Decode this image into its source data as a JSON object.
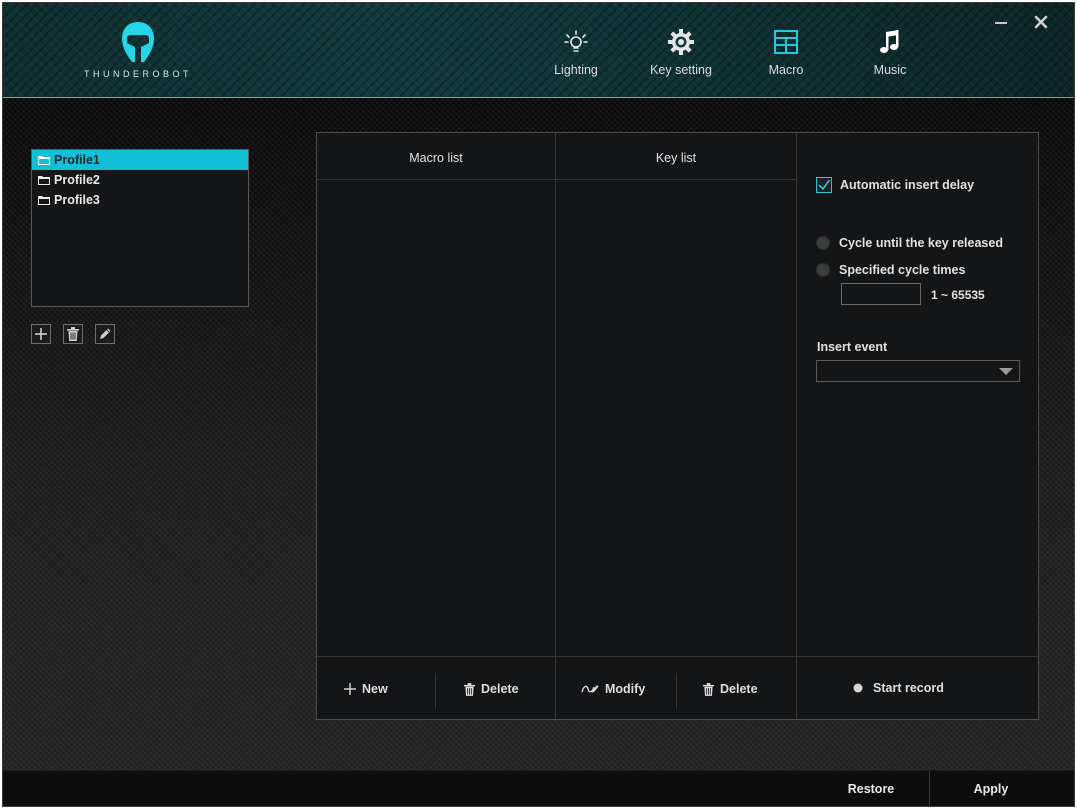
{
  "app": {
    "brand_name": "THUNDEROBOT",
    "accent_color": "#12c0d6"
  },
  "nav": {
    "tabs": [
      {
        "label": "Lighting",
        "icon": "light-bulb-icon"
      },
      {
        "label": "Key setting",
        "icon": "gear-icon"
      },
      {
        "label": "Macro",
        "icon": "grid-table-icon",
        "active": true
      },
      {
        "label": "Music",
        "icon": "music-note-icon"
      }
    ]
  },
  "window_controls": {
    "minimize_icon": "minimize-icon",
    "close_icon": "close-icon"
  },
  "profiles": {
    "items": [
      "Profile1",
      "Profile2",
      "Profile3"
    ],
    "selected": "Profile1",
    "tools": [
      "plus-icon",
      "trash-icon",
      "pencil-icon"
    ]
  },
  "macro_panel": {
    "macro_list_header": "Macro list",
    "key_list_header": "Key list",
    "new_label": "New",
    "delete_macro_label": "Delete",
    "modify_label": "Modify",
    "delete_key_label": "Delete",
    "start_record_label": "Start record"
  },
  "options": {
    "auto_insert_delay_label": "Automatic insert delay",
    "auto_insert_delay_checked": true,
    "cycle_released_label": "Cycle until the key released",
    "specified_times_label": "Specified cycle times",
    "cycle_times_value": "",
    "cycle_range_label": "1 ~ 65535",
    "insert_event_label": "Insert event",
    "insert_event_value": ""
  },
  "bottom": {
    "restore_label": "Restore",
    "apply_label": "Apply"
  }
}
